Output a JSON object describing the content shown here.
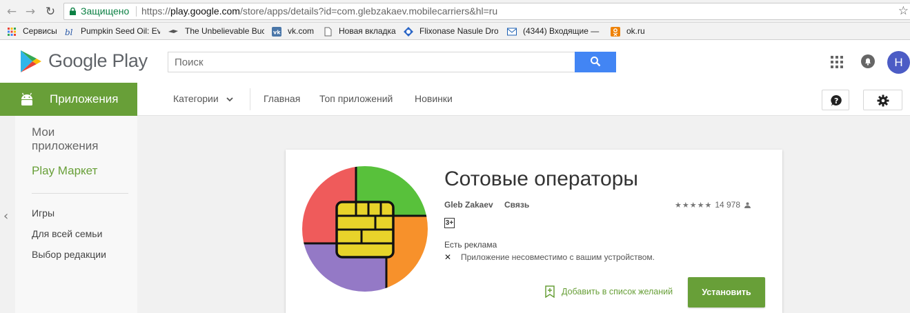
{
  "browser": {
    "secure_label": "Защищено",
    "url_scheme": "https://",
    "url_host": "play.google.com",
    "url_path": "/store/apps/details?id=com.glebzakaev.mobilecarriers&hl=ru",
    "bookmarks": [
      {
        "label": "Сервисы",
        "icon": "apps-grid-icon"
      },
      {
        "label": "Pumpkin Seed Oil: Ev",
        "icon": "site-icon"
      },
      {
        "label": "The Unbelievable Buc",
        "icon": "site-icon"
      },
      {
        "label": "vk.com",
        "icon": "vk-icon"
      },
      {
        "label": "Новая вкладка",
        "icon": "page-icon"
      },
      {
        "label": "Flixonase Nasule Dro",
        "icon": "site-icon"
      },
      {
        "label": "(4344) Входящие — ",
        "icon": "mail-icon"
      },
      {
        "label": "ok.ru",
        "icon": "ok-icon"
      }
    ]
  },
  "header": {
    "brand": "Google Play",
    "search_placeholder": "Поиск",
    "avatar_letter": "Н"
  },
  "nav": {
    "apps_tab": "Приложения",
    "categories": "Категории",
    "home": "Главная",
    "top": "Топ приложений",
    "new": "Новинки"
  },
  "sidebar": {
    "my_apps": "Мои приложения",
    "play_market": "Play Маркет",
    "links": [
      "Игры",
      "Для всей семьи",
      "Выбор редакции"
    ]
  },
  "app": {
    "title": "Сотовые операторы",
    "developer": "Gleb Zakaev",
    "category": "Связь",
    "rating_stars": "★★★★★",
    "rating_count": "14 978",
    "age_rating": "3+",
    "ads_notice": "Есть реклама",
    "incompatible": "Приложение несовместимо с вашим устройством.",
    "wishlist": "Добавить в список желаний",
    "install": "Установить"
  },
  "colors": {
    "play_green": "#689f38",
    "search_blue": "#4285f4",
    "avatar": "#4c5cc5",
    "icon_red": "#ef5b5b",
    "icon_green": "#58c13b",
    "icon_orange": "#f7912b",
    "icon_purple": "#9479c6",
    "icon_chip": "#e8d32a"
  }
}
